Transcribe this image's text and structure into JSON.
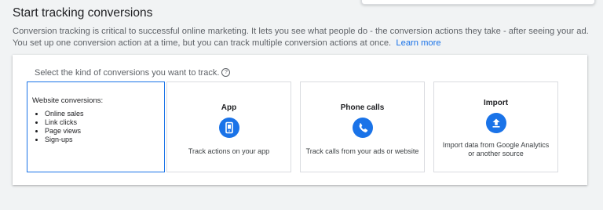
{
  "header": {
    "title": "Start tracking conversions",
    "intro": "Conversion tracking is critical to successful online marketing. It lets you see what people do - the conversion actions they take - after seeing your ad. You set up one conversion action at a time, but you can track multiple conversion actions at once.",
    "learn_more": "Learn more"
  },
  "card": {
    "prompt": "Select the kind of conversions you want to track.",
    "help_glyph": "?",
    "options": [
      {
        "title": "Website conversions:",
        "items": [
          "Online sales",
          "Link clicks",
          "Page views",
          "Sign-ups"
        ],
        "selected": true
      },
      {
        "title": "App",
        "icon": "mobile-app-icon",
        "description": "Track actions on your app"
      },
      {
        "title": "Phone calls",
        "icon": "phone-icon",
        "description": "Track calls from your ads or website"
      },
      {
        "title": "Import",
        "icon": "upload-icon",
        "description": "Import data from Google Analytics or another source"
      }
    ]
  },
  "colors": {
    "accent": "#1a73e8",
    "background": "#f1f3f4",
    "card": "#ffffff",
    "text": "#202124",
    "muted": "#5f6368"
  }
}
